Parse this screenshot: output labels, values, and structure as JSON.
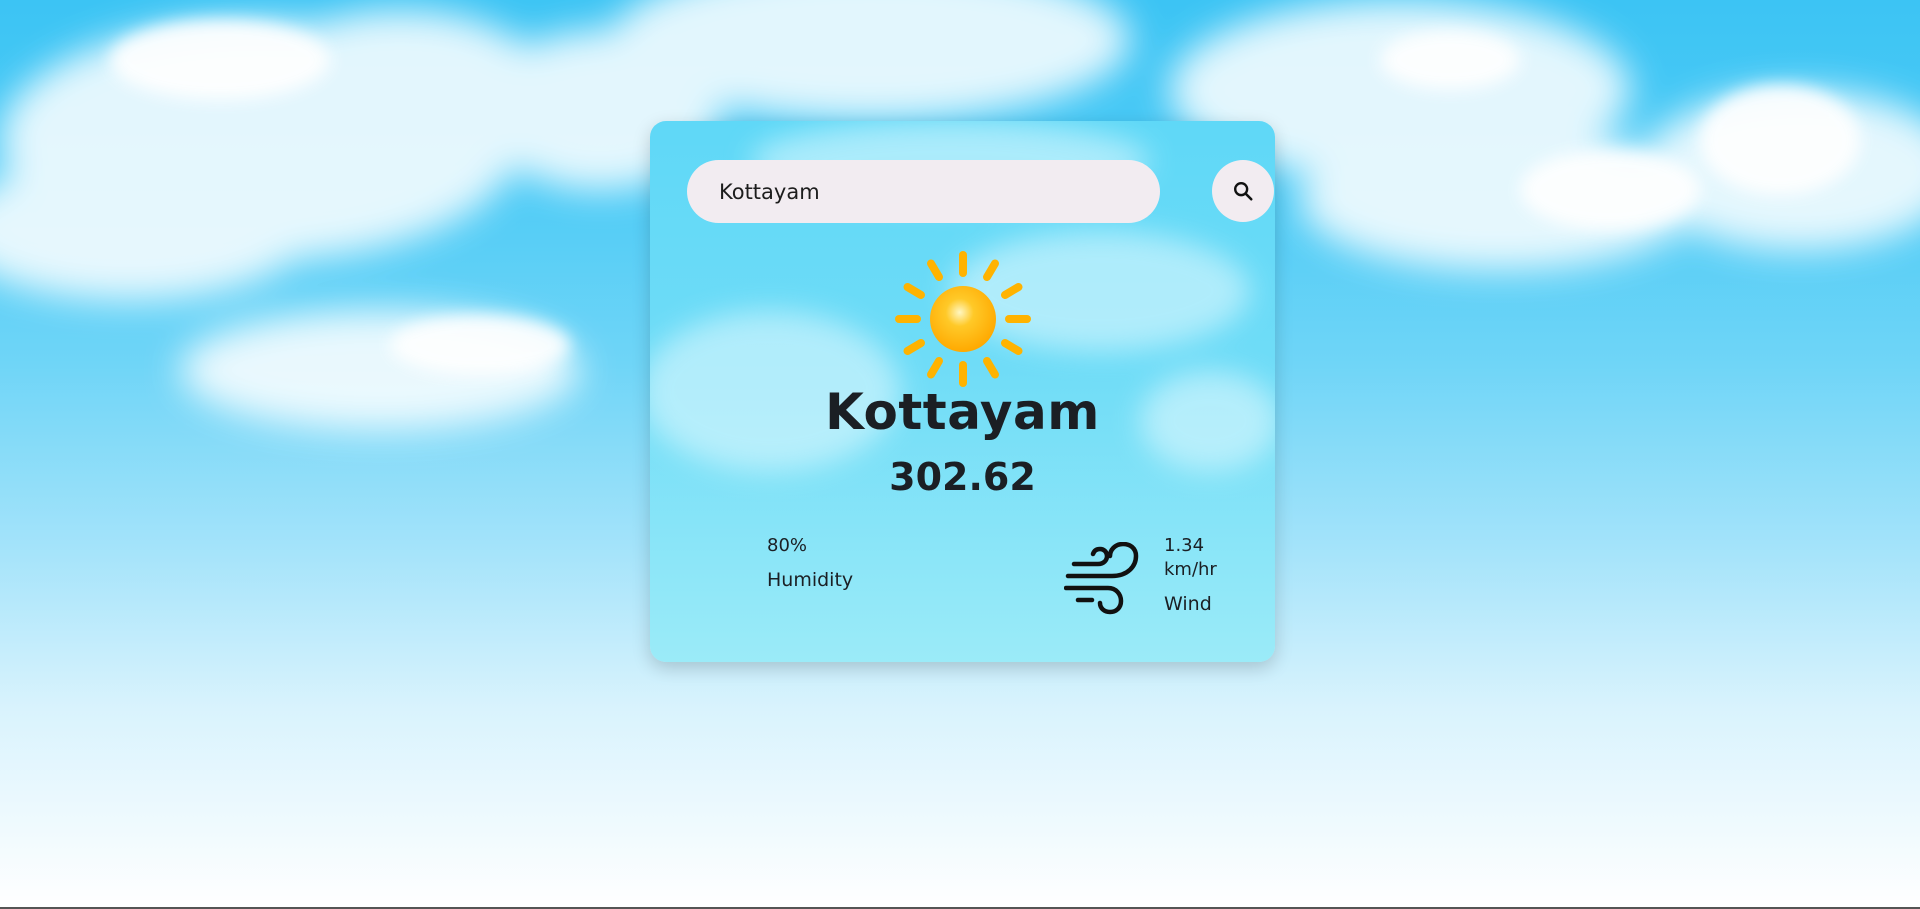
{
  "search": {
    "value": "Kottayam",
    "placeholder": ""
  },
  "weather": {
    "icon": "sun-icon",
    "city": "Kottayam",
    "temperature": "302.62"
  },
  "details": {
    "humidity": {
      "value": "80%",
      "label": "Humidity"
    },
    "wind": {
      "value": "1.34 km/hr",
      "label": "Wind",
      "icon": "wind-icon"
    }
  },
  "colors": {
    "sky_top": "#3cc4f4",
    "card": "#6fdcf7",
    "sun": "#ffb300",
    "input_bg": "#f2ecf1",
    "text": "#1b1f24"
  }
}
